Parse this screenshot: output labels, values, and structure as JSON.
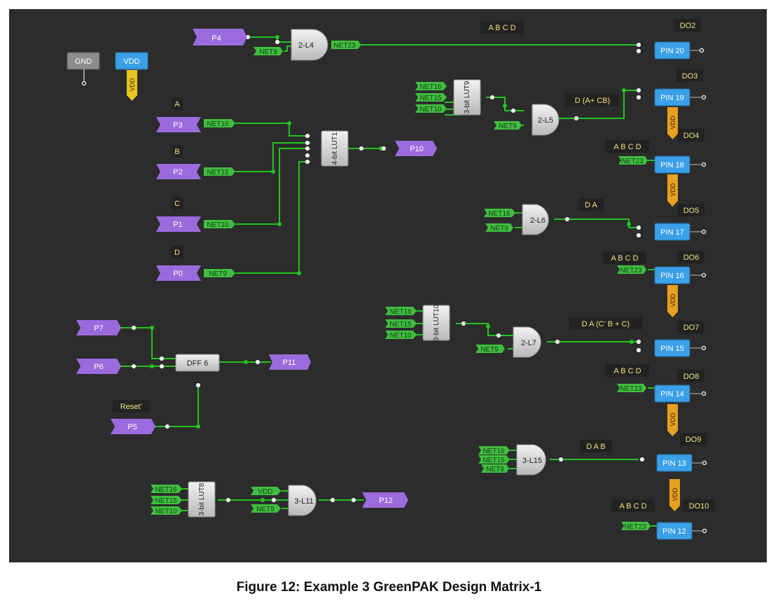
{
  "caption": "Figure 12: Example 3 GreenPAK Design Matrix-1",
  "colors": {
    "background": "#2c2c2c",
    "wire": "#22c41e",
    "port": "#9b6bde",
    "net_tag": "#3fbf3f",
    "pin": "#3aa0e8",
    "vdd_tag": "#e8a020",
    "gate": "#d6d6d6",
    "label_text": "#f5e27a"
  },
  "supplies": {
    "gnd": "GND",
    "vdd": "VDD",
    "vdd_tag": "VDD"
  },
  "ports": {
    "p4": "P4",
    "p3": "P3",
    "p2": "P2",
    "p1": "P1",
    "p0": "P0",
    "p10": "P10",
    "p7": "P7",
    "p6": "P6",
    "p11": "P11",
    "p5": "P5",
    "p12": "P12"
  },
  "nets": {
    "net9": "NET9",
    "net10": "NET10",
    "net15": "NET15",
    "net16": "NET16",
    "net23": "NET23"
  },
  "blocks": {
    "and_2l4": "2-L4",
    "lut1": "4-bit LUT1",
    "lut9": "3-bit LUT9",
    "and_2l5": "2-L5",
    "and_2l6": "2-L6",
    "lut10": "3-bit LUT10",
    "and_2l7": "2-L7",
    "dff6": "DFF 6",
    "and_3l15": "3-L15",
    "lut8": "3-bit LUT8",
    "and_3l11": "3-L11"
  },
  "pins": {
    "pin20": "PIN 20",
    "pin19": "PIN 19",
    "pin18": "PIN 18",
    "pin17": "PIN 17",
    "pin16": "PIN 16",
    "pin15": "PIN 15",
    "pin14": "PIN 14",
    "pin13": "PIN 13",
    "pin12": "PIN 12"
  },
  "labels": {
    "a": "A",
    "b": "B",
    "c": "C",
    "d": "D",
    "reset": "Reset'",
    "abcd": "A B C D",
    "do2": "DO2",
    "do3": "DO3",
    "do4": "DO4",
    "do5": "DO5",
    "do6": "DO6",
    "do7": "DO7",
    "do8": "DO8",
    "do9": "DO9",
    "do10": "DO10",
    "expr_l5": "D (A+ CB)",
    "expr_l6": "D A",
    "expr_l7": "D A (C' B + C)",
    "expr_l15": "D A B"
  }
}
